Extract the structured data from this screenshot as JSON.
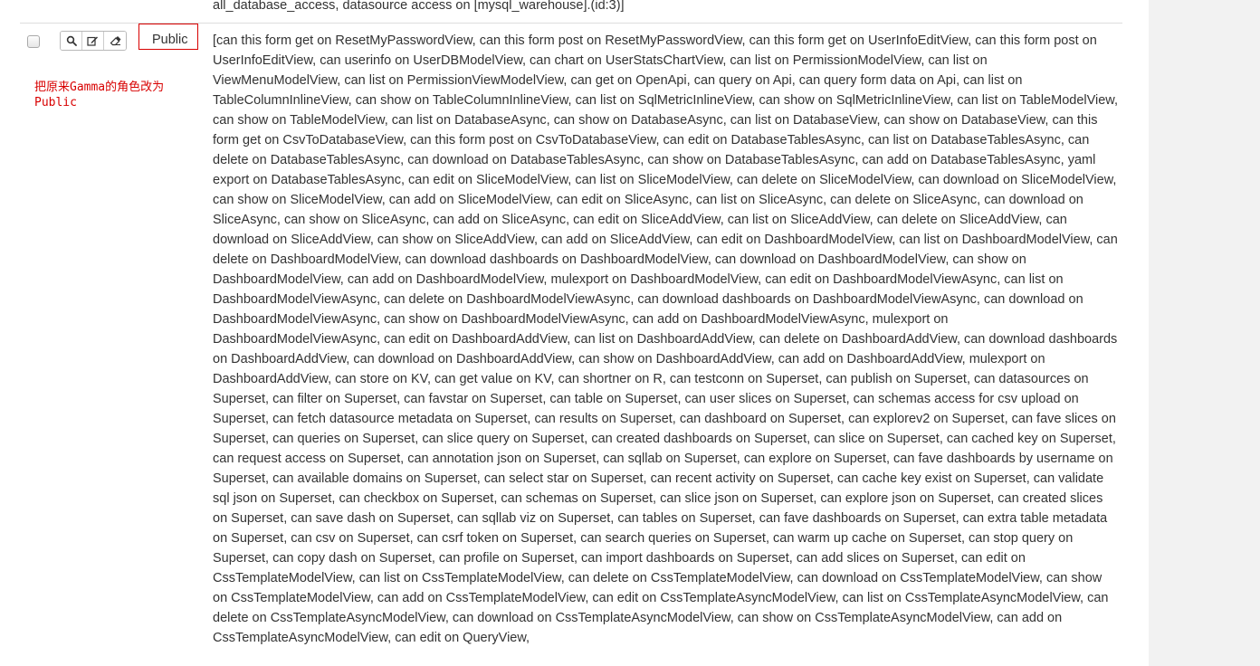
{
  "previous_row": {
    "permissions_tail": "all_database_access, datasource access on [mysql_warehouse].(id:3)]"
  },
  "row": {
    "actions": {
      "show_icon": "search-icon",
      "edit_icon": "edit-icon",
      "delete_icon": "eraser-icon"
    },
    "role_name": "Public",
    "annotation": "把原来Gamma的角色改为Public",
    "permissions": "[can this form get on ResetMyPasswordView, can this form post on ResetMyPasswordView, can this form get on UserInfoEditView, can this form post on UserInfoEditView, can userinfo on UserDBModelView, can chart on UserStatsChartView, can list on PermissionModelView, can list on ViewMenuModelView, can list on PermissionViewModelView, can get on OpenApi, can query on Api, can query form data on Api, can list on TableColumnInlineView, can show on TableColumnInlineView, can list on SqlMetricInlineView, can show on SqlMetricInlineView, can list on TableModelView, can show on TableModelView, can list on DatabaseAsync, can show on DatabaseAsync, can list on DatabaseView, can show on DatabaseView, can this form get on CsvToDatabaseView, can this form post on CsvToDatabaseView, can edit on DatabaseTablesAsync, can list on DatabaseTablesAsync, can delete on DatabaseTablesAsync, can download on DatabaseTablesAsync, can show on DatabaseTablesAsync, can add on DatabaseTablesAsync, yaml export on DatabaseTablesAsync, can edit on SliceModelView, can list on SliceModelView, can delete on SliceModelView, can download on SliceModelView, can show on SliceModelView, can add on SliceModelView, can edit on SliceAsync, can list on SliceAsync, can delete on SliceAsync, can download on SliceAsync, can show on SliceAsync, can add on SliceAsync, can edit on SliceAddView, can list on SliceAddView, can delete on SliceAddView, can download on SliceAddView, can show on SliceAddView, can add on SliceAddView, can edit on DashboardModelView, can list on DashboardModelView, can delete on DashboardModelView, can download dashboards on DashboardModelView, can download on DashboardModelView, can show on DashboardModelView, can add on DashboardModelView, mulexport on DashboardModelView, can edit on DashboardModelViewAsync, can list on DashboardModelViewAsync, can delete on DashboardModelViewAsync, can download dashboards on DashboardModelViewAsync, can download on DashboardModelViewAsync, can show on DashboardModelViewAsync, can add on DashboardModelViewAsync, mulexport on DashboardModelViewAsync, can edit on DashboardAddView, can list on DashboardAddView, can delete on DashboardAddView, can download dashboards on DashboardAddView, can download on DashboardAddView, can show on DashboardAddView, can add on DashboardAddView, mulexport on DashboardAddView, can store on KV, can get value on KV, can shortner on R, can testconn on Superset, can publish on Superset, can datasources on Superset, can filter on Superset, can favstar on Superset, can table on Superset, can user slices on Superset, can schemas access for csv upload on Superset, can fetch datasource metadata on Superset, can results on Superset, can dashboard on Superset, can explorev2 on Superset, can fave slices on Superset, can queries on Superset, can slice query on Superset, can created dashboards on Superset, can slice on Superset, can cached key on Superset, can request access on Superset, can annotation json on Superset, can sqllab on Superset, can explore on Superset, can fave dashboards by username on Superset, can available domains on Superset, can select star on Superset, can recent activity on Superset, can cache key exist on Superset, can validate sql json on Superset, can checkbox on Superset, can schemas on Superset, can slice json on Superset, can explore json on Superset, can created slices on Superset, can save dash on Superset, can sqllab viz on Superset, can tables on Superset, can fave dashboards on Superset, can extra table metadata on Superset, can csv on Superset, can csrf token on Superset, can search queries on Superset, can warm up cache on Superset, can stop query on Superset, can copy dash on Superset, can profile on Superset, can import dashboards on Superset, can add slices on Superset, can edit on CssTemplateModelView, can list on CssTemplateModelView, can delete on CssTemplateModelView, can download on CssTemplateModelView, can show on CssTemplateModelView, can add on CssTemplateModelView, can edit on CssTemplateAsyncModelView, can list on CssTemplateAsyncModelView, can delete on CssTemplateAsyncModelView, can download on CssTemplateAsyncModelView, can show on CssTemplateAsyncModelView, can add on CssTemplateAsyncModelView, can edit on QueryView,"
  },
  "colors": {
    "annotation_red": "#d80000",
    "text": "#333333",
    "divider": "#dddddd",
    "gutter": "#f2f2f2"
  }
}
